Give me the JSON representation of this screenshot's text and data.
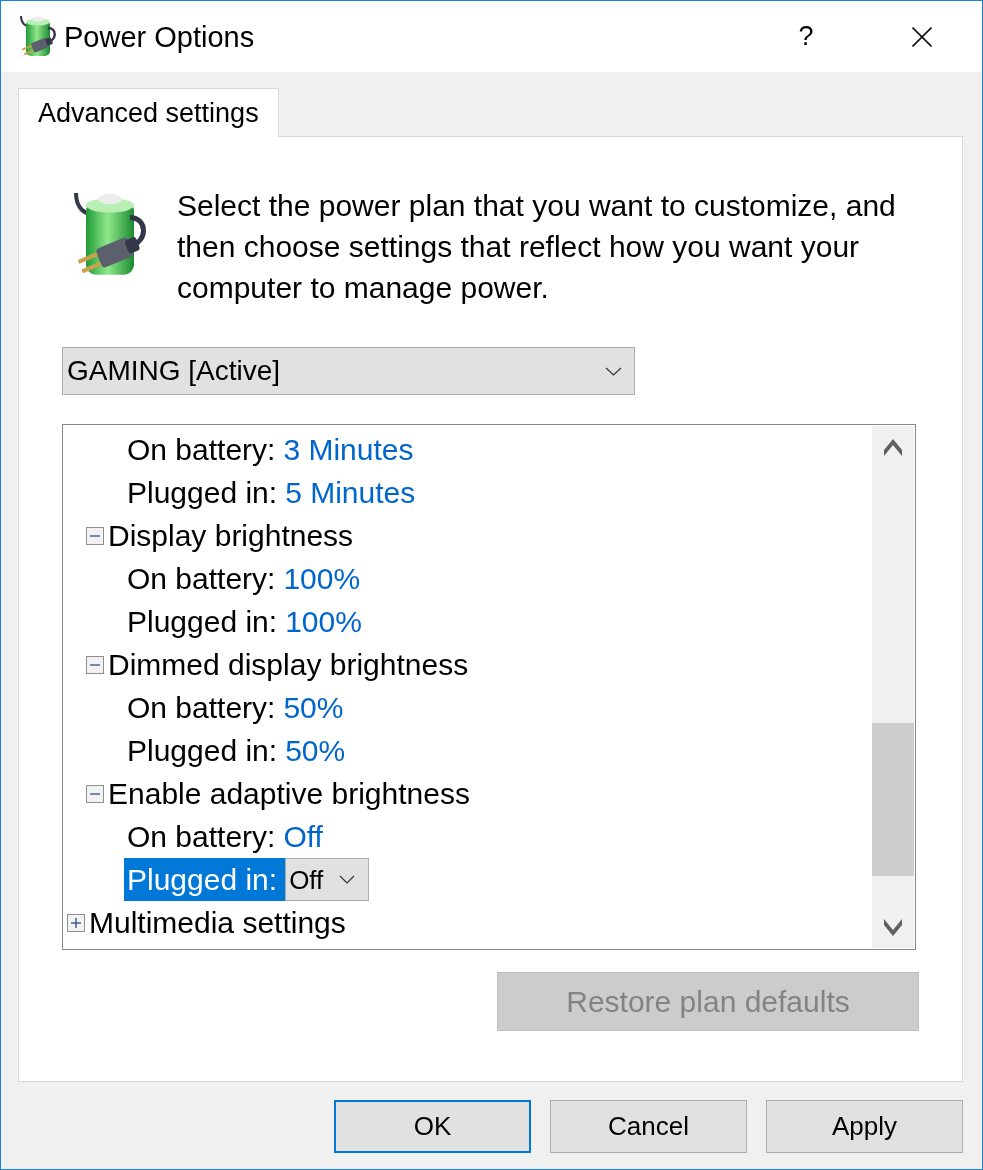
{
  "window": {
    "title": "Power Options",
    "help_button": "?"
  },
  "tabs": [
    {
      "label": "Advanced settings",
      "selected": true
    }
  ],
  "description": "Select the power plan that you want to customize, and then choose settings that reflect how you want your computer to manage power.",
  "plan_dropdown": {
    "value": "GAMING [Active]"
  },
  "settings_tree": {
    "items": [
      {
        "kind": "group",
        "children": [
          {
            "kind": "group",
            "children": [
              {
                "kind": "setting",
                "label": "On battery:",
                "value": "3 Minutes",
                "selected": false
              },
              {
                "kind": "setting",
                "label": "Plugged in:",
                "value": "5 Minutes",
                "selected": false
              }
            ]
          },
          {
            "kind": "group",
            "label": "Display brightness",
            "expanded": true,
            "children": [
              {
                "kind": "setting",
                "label": "On battery:",
                "value": "100%",
                "selected": false
              },
              {
                "kind": "setting",
                "label": "Plugged in:",
                "value": "100%",
                "selected": false
              }
            ]
          },
          {
            "kind": "group",
            "label": "Dimmed display brightness",
            "expanded": true,
            "children": [
              {
                "kind": "setting",
                "label": "On battery:",
                "value": "50%",
                "selected": false
              },
              {
                "kind": "setting",
                "label": "Plugged in:",
                "value": "50%",
                "selected": false
              }
            ]
          },
          {
            "kind": "group",
            "label": "Enable adaptive brightness",
            "expanded": true,
            "children": [
              {
                "kind": "setting",
                "label": "On battery:",
                "value": "Off",
                "selected": false
              },
              {
                "kind": "setting",
                "label": "Plugged in:",
                "value": "Off",
                "selected": true
              }
            ]
          }
        ]
      },
      {
        "kind": "group",
        "label": "Multimedia settings",
        "expanded": false
      }
    ]
  },
  "restore_button": {
    "label": "Restore plan defaults",
    "disabled": true
  },
  "buttons": [
    {
      "label": "OK",
      "default": true
    },
    {
      "label": "Cancel",
      "default": false
    },
    {
      "label": "Apply",
      "default": false
    }
  ]
}
